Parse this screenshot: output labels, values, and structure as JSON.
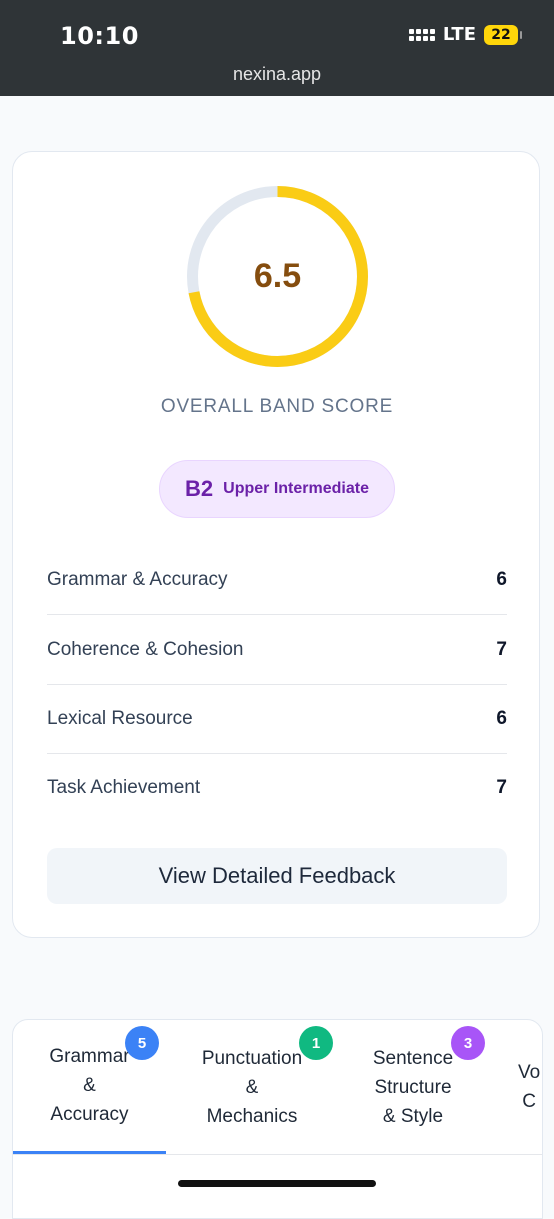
{
  "status_bar": {
    "time": "10:10",
    "network": "LTE",
    "battery": "22"
  },
  "browser": {
    "url": "nexina.app"
  },
  "score_card": {
    "overall_score": "6.5",
    "overall_fraction": 0.72,
    "overall_label": "OVERALL BAND SCORE",
    "level_code": "B2",
    "level_name": "Upper Intermediate",
    "criteria": [
      {
        "name": "Grammar & Accuracy",
        "score": "6"
      },
      {
        "name": "Coherence & Cohesion",
        "score": "7"
      },
      {
        "name": "Lexical Resource",
        "score": "6"
      },
      {
        "name": "Task Achievement",
        "score": "7"
      }
    ],
    "feedback_button": "View Detailed Feedback"
  },
  "tabs": [
    {
      "label": "Grammar\n&\nAccuracy",
      "count": "5",
      "badge_color": "#3b82f6",
      "active": true
    },
    {
      "label": "Punctuation\n&\nMechanics",
      "count": "1",
      "badge_color": "#10b981",
      "active": false
    },
    {
      "label": "Sentence\nStructure\n& Style",
      "count": "3",
      "badge_color": "#a855f7",
      "active": false
    },
    {
      "label": "Vo\nC",
      "count": "",
      "badge_color": "",
      "active": false
    }
  ],
  "colors": {
    "ring_fill": "#facc15",
    "ring_track": "#e2e8f0",
    "score_text": "#854d0e",
    "level_accent": "#6b21a8",
    "tab_active": "#3b82f6"
  }
}
